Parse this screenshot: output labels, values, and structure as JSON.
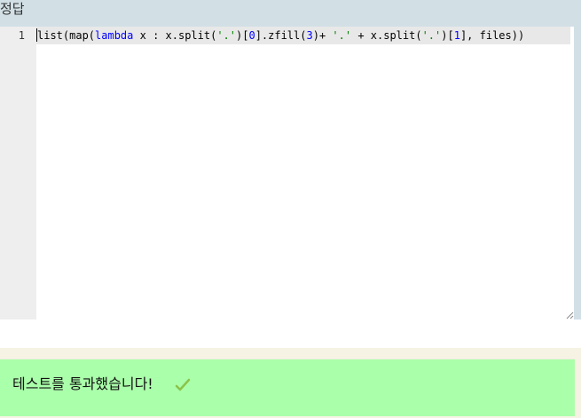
{
  "answer": {
    "title": "정답",
    "line_numbers": [
      "1"
    ],
    "code_tokens": [
      {
        "text": "list(map(",
        "kind": "plain"
      },
      {
        "text": "lambda",
        "kind": "kw"
      },
      {
        "text": " x : x.split(",
        "kind": "plain"
      },
      {
        "text": "'.'",
        "kind": "str"
      },
      {
        "text": ")[",
        "kind": "plain"
      },
      {
        "text": "0",
        "kind": "num"
      },
      {
        "text": "].zfill(",
        "kind": "plain"
      },
      {
        "text": "3",
        "kind": "num"
      },
      {
        "text": ")+ ",
        "kind": "plain"
      },
      {
        "text": "'.'",
        "kind": "str"
      },
      {
        "text": " + x.split(",
        "kind": "plain"
      },
      {
        "text": "'.'",
        "kind": "str"
      },
      {
        "text": ")[",
        "kind": "plain"
      },
      {
        "text": "1",
        "kind": "num"
      },
      {
        "text": "], files))",
        "kind": "plain"
      }
    ]
  },
  "result": {
    "message": "테스트를 통과했습니다!",
    "icon": "checkmark-icon",
    "status_color": "#aaffaa"
  },
  "colors": {
    "panel_background": "#d2e0e6",
    "gutter": "#eeeeee",
    "active_line": "#e8e8e8",
    "keyword": "#0000ff",
    "string": "#008000",
    "check": "#8bc34a"
  }
}
